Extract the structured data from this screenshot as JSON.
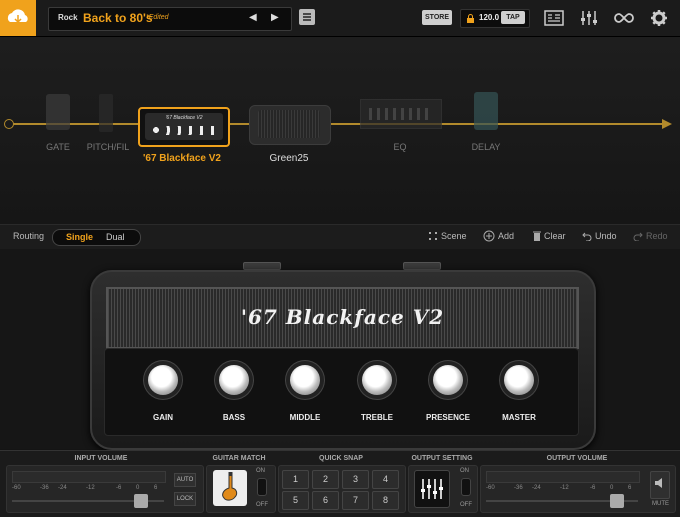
{
  "header": {
    "genre": "Rock",
    "preset_name": "Back to 80's",
    "edited": "*Edited",
    "prev_icon": "◀",
    "next_icon": "▶",
    "store_label": "STORE",
    "tempo": "120.0",
    "tap_label": "TAP"
  },
  "chain": {
    "blocks": [
      {
        "label": "GATE"
      },
      {
        "label": "PITCH/FIL"
      },
      {
        "label": "'67 Blackface V2",
        "active": true
      },
      {
        "label": "Green25"
      },
      {
        "label": "EQ"
      },
      {
        "label": "DELAY"
      }
    ],
    "amp_badge": "'67 Blackface V2"
  },
  "routing": {
    "label": "Routing",
    "single": "Single",
    "dual": "Dual",
    "scene": "Scene",
    "add": "Add",
    "clear": "Clear",
    "undo": "Undo",
    "redo": "Redo"
  },
  "amp": {
    "name": "'67 Blackface V2",
    "knobs": [
      "GAIN",
      "BASS",
      "MIDDLE",
      "TREBLE",
      "PRESENCE",
      "MASTER"
    ]
  },
  "bottom": {
    "input_volume": "INPUT VOLUME",
    "guitar_match": "GUITAR MATCH",
    "quick_snap": "QUICK SNAP",
    "output_setting": "OUTPUT SETTING",
    "output_volume": "OUTPUT VOLUME",
    "scale": [
      "-60",
      "-36",
      "-24",
      "-12",
      "-6",
      "0",
      "6"
    ],
    "auto": "AUTO",
    "lock": "LOCK",
    "on": "ON",
    "off": "OFF",
    "mute": "MUTE",
    "snaps": [
      "1",
      "2",
      "3",
      "4",
      "5",
      "6",
      "7",
      "8"
    ]
  },
  "colors": {
    "accent": "#f0a21c"
  }
}
